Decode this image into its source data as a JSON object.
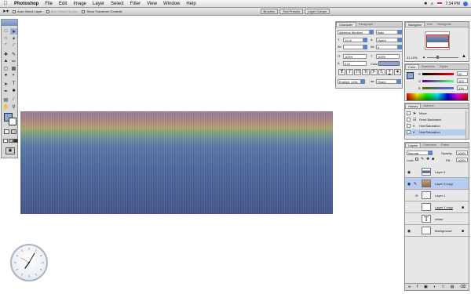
{
  "menubar": {
    "app": "Photoshop",
    "items": [
      "File",
      "Edit",
      "Image",
      "Layer",
      "Select",
      "Filter",
      "View",
      "Window",
      "Help"
    ],
    "clock": "7:34 PM"
  },
  "options": {
    "auto_select_layer": "Auto Select Layer",
    "auto_select_groups": "Auto Select Groups",
    "show_transform": "Show Transform Controls",
    "wells": [
      "Brushes",
      "Tool Presets",
      "Layer Comps"
    ]
  },
  "character": {
    "tabs": [
      "Character",
      "Paragraph"
    ],
    "font": "Albertus Medium",
    "style": "Italic",
    "size": "11 pt",
    "leading": "(Auto)",
    "tracking": "0",
    "vscale": "100%",
    "hscale": "100%",
    "baseline": "0 pt",
    "color_label": "Color:",
    "language": "English: USA",
    "aa": "Sharp",
    "color": "#8aa6d6"
  },
  "navigator": {
    "tabs": [
      "Navigator",
      "Info",
      "Histogram"
    ],
    "zoom": "31.15%"
  },
  "color": {
    "tabs": [
      "Color",
      "Swatches",
      "Styles"
    ],
    "r": "90",
    "g": "103",
    "b": "134"
  },
  "history": {
    "tabs": [
      "History",
      "Actions"
    ],
    "items": [
      "Move",
      "Send Backward",
      "Hue/Saturation",
      "Hue/Saturation"
    ]
  },
  "layers": {
    "tabs": [
      "Layers",
      "Channels",
      "Paths"
    ],
    "blend": "Normal",
    "opacity_label": "Opacity:",
    "opacity": "100%",
    "lock_label": "Lock:",
    "fill_label": "Fill:",
    "fill": "100%",
    "items": [
      "Layer 5",
      "Layer 3 copy",
      "Layer 1",
      "Layer 1 copy",
      "ovlaw",
      "Background"
    ]
  }
}
